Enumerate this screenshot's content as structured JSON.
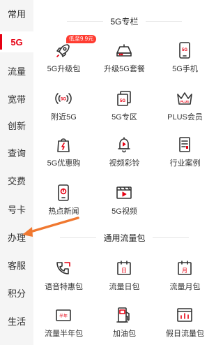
{
  "sidebar": {
    "items": [
      {
        "label": "常用",
        "active": false
      },
      {
        "label": "5G",
        "active": true
      },
      {
        "label": "流量",
        "active": false
      },
      {
        "label": "宽带",
        "active": false
      },
      {
        "label": "创新",
        "active": false
      },
      {
        "label": "查询",
        "active": false
      },
      {
        "label": "交费",
        "active": false
      },
      {
        "label": "号卡",
        "active": false
      },
      {
        "label": "办理",
        "active": false
      },
      {
        "label": "客服",
        "active": false
      },
      {
        "label": "积分",
        "active": false
      },
      {
        "label": "生活",
        "active": false
      }
    ]
  },
  "sections": [
    {
      "title": "5G专栏",
      "items": [
        {
          "label": "5G升级包",
          "icon": "rocket-icon",
          "badge": "低至9.9元"
        },
        {
          "label": "升级5G套餐",
          "icon": "router-icon"
        },
        {
          "label": "5G手机",
          "icon": "phone-5g-icon"
        },
        {
          "label": "附近5G",
          "icon": "signal-5g-icon"
        },
        {
          "label": "5G专区",
          "icon": "cards-5g-icon"
        },
        {
          "label": "PLUS会员",
          "icon": "crown-plus-icon"
        },
        {
          "label": "5G优惠购",
          "icon": "shopping-bag-icon"
        },
        {
          "label": "视频彩铃",
          "icon": "bell-icon"
        },
        {
          "label": "行业案例",
          "icon": "document-icon"
        },
        {
          "label": "热点新闻",
          "icon": "news-phone-icon"
        },
        {
          "label": "5G视频",
          "icon": "video-icon"
        }
      ]
    },
    {
      "title": "通用流量包",
      "items": [
        {
          "label": "语音特惠包",
          "icon": "phone-call-icon"
        },
        {
          "label": "流量日包",
          "icon": "calendar-day-icon",
          "glyph": "日"
        },
        {
          "label": "流量月包",
          "icon": "calendar-month-icon",
          "glyph": "月"
        },
        {
          "label": "流量半年包",
          "icon": "half-year-icon",
          "glyph": "半年"
        },
        {
          "label": "加油包",
          "icon": "fuel-icon"
        },
        {
          "label": "假日流量包",
          "icon": "holiday-chart-icon"
        }
      ]
    }
  ],
  "colors": {
    "accent": "#e60012",
    "sidebar_bg": "#f5f5f5",
    "arrow": "#f07830",
    "badge": "#ff3b30"
  }
}
